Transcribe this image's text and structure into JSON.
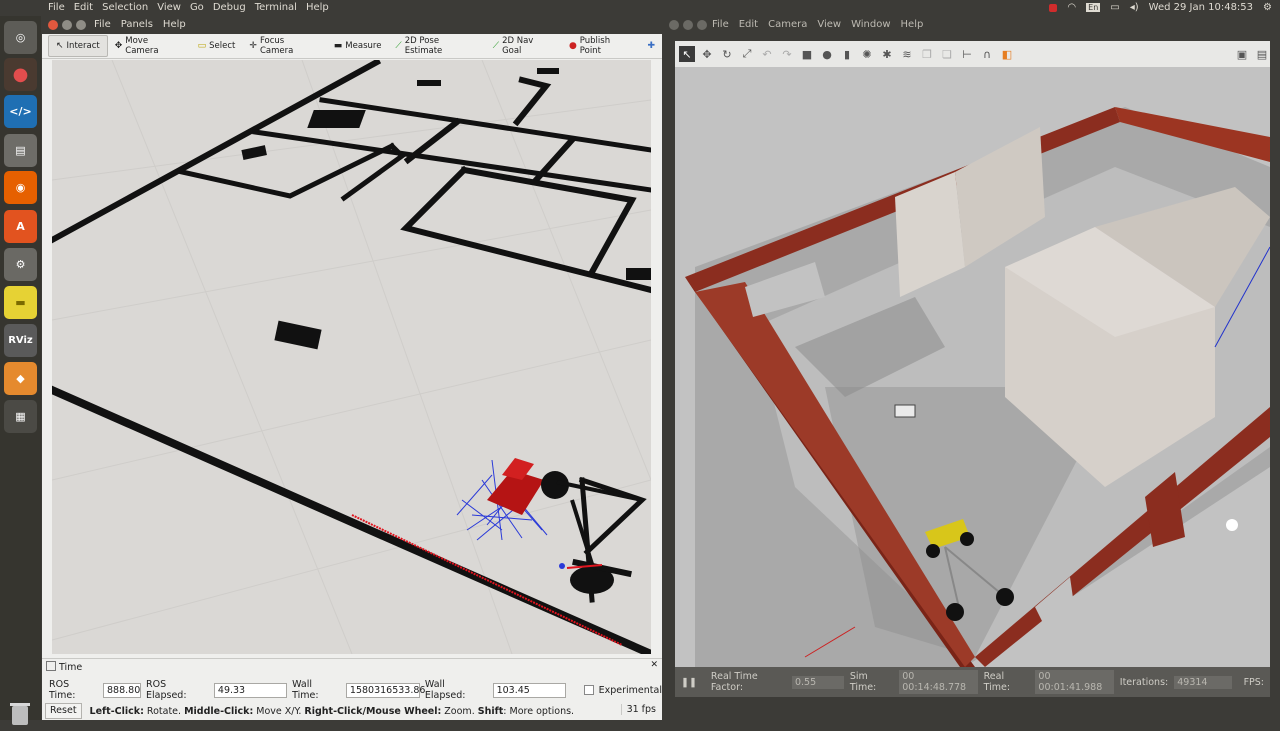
{
  "topbar": {
    "menu": [
      "File",
      "Edit",
      "Selection",
      "View",
      "Go",
      "Debug",
      "Terminal",
      "Help"
    ],
    "clock": "Wed 29 Jan 10:48:53"
  },
  "launcher": {
    "rviz_label": "RViz"
  },
  "rviz": {
    "menu": [
      "File",
      "Panels",
      "Help"
    ],
    "tools": [
      "Interact",
      "Move Camera",
      "Select",
      "Focus Camera",
      "Measure",
      "2D Pose Estimate",
      "2D Nav Goal",
      "Publish Point"
    ],
    "time_panel": {
      "title": "Time",
      "ros_time_label": "ROS Time:",
      "ros_time": "888.80",
      "ros_elapsed_label": "ROS Elapsed:",
      "ros_elapsed": "49.33",
      "wall_time_label": "Wall Time:",
      "wall_time": "1580316533.86",
      "wall_elapsed_label": "Wall Elapsed:",
      "wall_elapsed": "103.45",
      "experimental_label": "Experimental"
    },
    "status": {
      "reset_label": "Reset",
      "b1": "Left-Click:",
      "t1": " Rotate. ",
      "b2": "Middle-Click:",
      "t2": " Move X/Y. ",
      "b3": "Right-Click/Mouse Wheel:",
      "t3": " Zoom. ",
      "b4": "Shift",
      "t4": ": More options.",
      "fps": "31 fps"
    }
  },
  "gazebo": {
    "menu": [
      "File",
      "Edit",
      "Camera",
      "View",
      "Window",
      "Help"
    ],
    "bottom": {
      "rtf_label": "Real Time Factor:",
      "rtf": "0.55",
      "sim_label": "Sim Time:",
      "sim": "00 00:14:48.778",
      "real_label": "Real Time:",
      "real": "00 00:01:41.988",
      "iter_label": "Iterations:",
      "iter": "49314",
      "fps_label": "FPS:"
    }
  }
}
